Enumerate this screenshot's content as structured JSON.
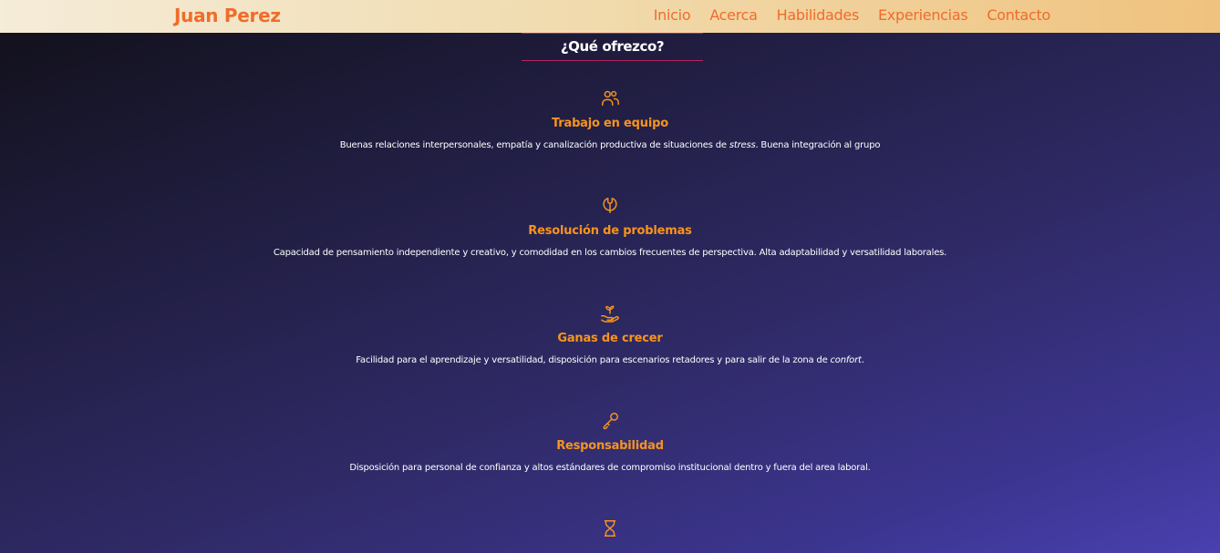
{
  "header": {
    "brand": "Juan Perez",
    "nav": [
      "Inicio",
      "Acerca",
      "Habilidades",
      "Experiencias",
      "Contacto"
    ]
  },
  "section": {
    "title": "¿Qué ofrezco?"
  },
  "offers": [
    {
      "icon": "team-icon",
      "title": "Trabajo en equipo",
      "desc_before": "Buenas relaciones interpersonales, empatía y canalización productiva de situaciones de ",
      "desc_em": "stress",
      "desc_after": ". Buena integración al grupo"
    },
    {
      "icon": "wrench-icon",
      "title": "Resolución de problemas",
      "desc_before": "Capacidad de pensamiento independiente y creativo, y comodidad en los cambios frecuentes de perspectiva. Alta adaptabilidad y versatilidad laborales.",
      "desc_em": "",
      "desc_after": ""
    },
    {
      "icon": "plant-hand-icon",
      "title": "Ganas de crecer",
      "desc_before": "Facilidad para el aprendizaje y versatilidad, disposición para escenarios retadores y para salir de la zona de ",
      "desc_em": "confort",
      "desc_after": "."
    },
    {
      "icon": "key-icon",
      "title": "Responsabilidad",
      "desc_before": "Disposición para personal de confianza y altos estándares de compromiso institucional dentro y fuera del area laboral.",
      "desc_em": "",
      "desc_after": ""
    },
    {
      "icon": "hourglass-icon"
    }
  ],
  "colors": {
    "accent": "#f06c2a",
    "offer_title": "#f7941d",
    "divider": "#b8245a"
  }
}
